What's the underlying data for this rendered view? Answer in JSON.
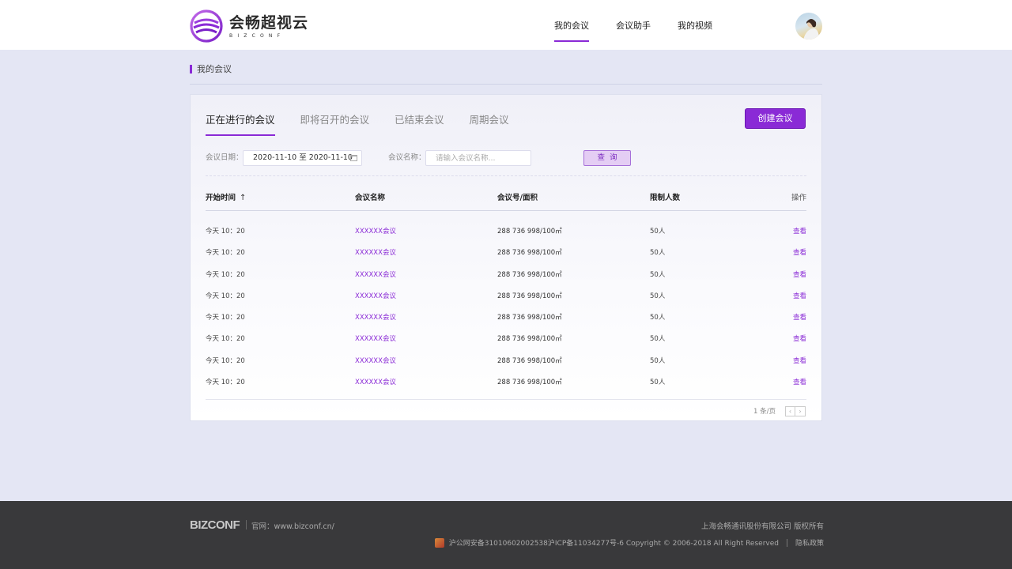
{
  "header": {
    "logo_cn": "会畅超视云",
    "logo_en": "BIZCONF",
    "nav": [
      {
        "label": "我的会议",
        "active": true
      },
      {
        "label": "会议助手",
        "active": false
      },
      {
        "label": "我的视频",
        "active": false
      }
    ]
  },
  "breadcrumb": "我的会议",
  "tabs": [
    {
      "label": "正在进行的会议",
      "active": true
    },
    {
      "label": "即将召开的会议",
      "active": false
    },
    {
      "label": "已结束会议",
      "active": false
    },
    {
      "label": "周期会议",
      "active": false
    }
  ],
  "create_button": "创建会议",
  "filters": {
    "date_label": "会议日期：",
    "date_range": "2020-11-10 至 2020-11-10",
    "name_label": "会议名称：",
    "name_placeholder": "请输入会议名称...",
    "query_button": "查询"
  },
  "table": {
    "headers": {
      "start_time": "开始时间",
      "sort_icon": "↑",
      "name": "会议名称",
      "number": "会议号/面积",
      "limit": "限制人数",
      "action": "操作"
    },
    "rows": [
      {
        "time": "今天  10：20",
        "name": "XXXXXX会议",
        "number": "288 736 998/100㎡",
        "limit": "50人",
        "action": "查看"
      },
      {
        "time": "今天  10：20",
        "name": "XXXXXX会议",
        "number": "288 736 998/100㎡",
        "limit": "50人",
        "action": "查看"
      },
      {
        "time": "今天  10：20",
        "name": "XXXXXX会议",
        "number": "288 736 998/100㎡",
        "limit": "50人",
        "action": "查看"
      },
      {
        "time": "今天  10：20",
        "name": "XXXXXX会议",
        "number": "288 736 998/100㎡",
        "limit": "50人",
        "action": "查看"
      },
      {
        "time": "今天  10：20",
        "name": "XXXXXX会议",
        "number": "288 736 998/100㎡",
        "limit": "50人",
        "action": "查看"
      },
      {
        "time": "今天  10：20",
        "name": "XXXXXX会议",
        "number": "288 736 998/100㎡",
        "limit": "50人",
        "action": "查看"
      },
      {
        "time": "今天  10：20",
        "name": "XXXXXX会议",
        "number": "288 736 998/100㎡",
        "limit": "50人",
        "action": "查看"
      },
      {
        "time": "今天  10：20",
        "name": "XXXXXX会议",
        "number": "288 736 998/100㎡",
        "limit": "50人",
        "action": "查看"
      }
    ]
  },
  "pagination": {
    "text": "1 条/页",
    "prev": "‹",
    "next": "›"
  },
  "footer": {
    "logo": "BIZCONF",
    "site": "官网：www.bizconf.cn/",
    "company": "上海会畅通讯股份有限公司 版权所有",
    "beian": "沪公网安备31010602002538沪ICP备11034277号-6 Copyright © 2006-2018 All Right Reserved",
    "privacy": "隐私政策"
  },
  "colors": {
    "accent": "#8a2ad6",
    "page_bg": "#e4e6f4",
    "footer_bg": "#39393b"
  }
}
